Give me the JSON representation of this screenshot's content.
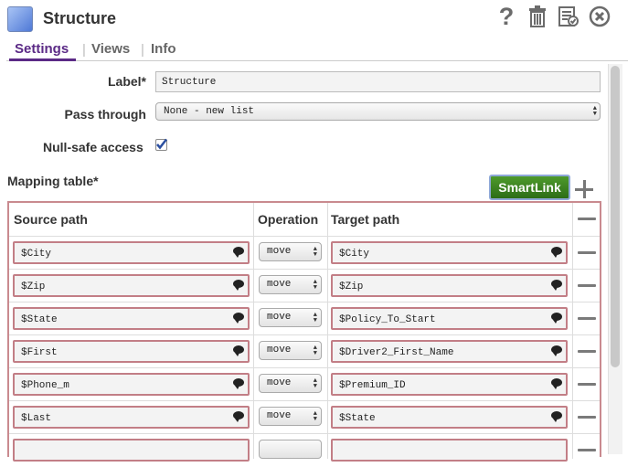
{
  "window": {
    "title": "Structure",
    "icon": "structure-snap-icon"
  },
  "header_icons": [
    "help-icon",
    "trash-icon",
    "checklist-icon",
    "close-icon"
  ],
  "tabs": [
    {
      "label": "Settings",
      "active": true
    },
    {
      "label": "Views",
      "active": false
    },
    {
      "label": "Info",
      "active": false
    }
  ],
  "fields": {
    "label": {
      "label": "Label*",
      "value": "Structure"
    },
    "pass_through": {
      "label": "Pass through",
      "value": "None - new list"
    },
    "null_safe": {
      "label": "Null-safe access",
      "checked": true
    }
  },
  "mapping": {
    "label": "Mapping table*",
    "smartlink_label": "SmartLink",
    "columns": {
      "source": "Source path",
      "operation": "Operation",
      "target": "Target path"
    },
    "rows": [
      {
        "source": "$City",
        "operation": "move",
        "target": "$City"
      },
      {
        "source": "$Zip",
        "operation": "move",
        "target": "$Zip"
      },
      {
        "source": "$State",
        "operation": "move",
        "target": "$Policy_To_Start"
      },
      {
        "source": "$First",
        "operation": "move",
        "target": "$Driver2_First_Name"
      },
      {
        "source": "$Phone_m",
        "operation": "move",
        "target": "$Premium_ID"
      },
      {
        "source": "$Last",
        "operation": "move",
        "target": "$State"
      }
    ]
  },
  "colors": {
    "tab_active": "#5b2a86",
    "smartlink": "#3a7f22",
    "field_border": "#c27e86",
    "checkbox": "#2b4fa0"
  }
}
